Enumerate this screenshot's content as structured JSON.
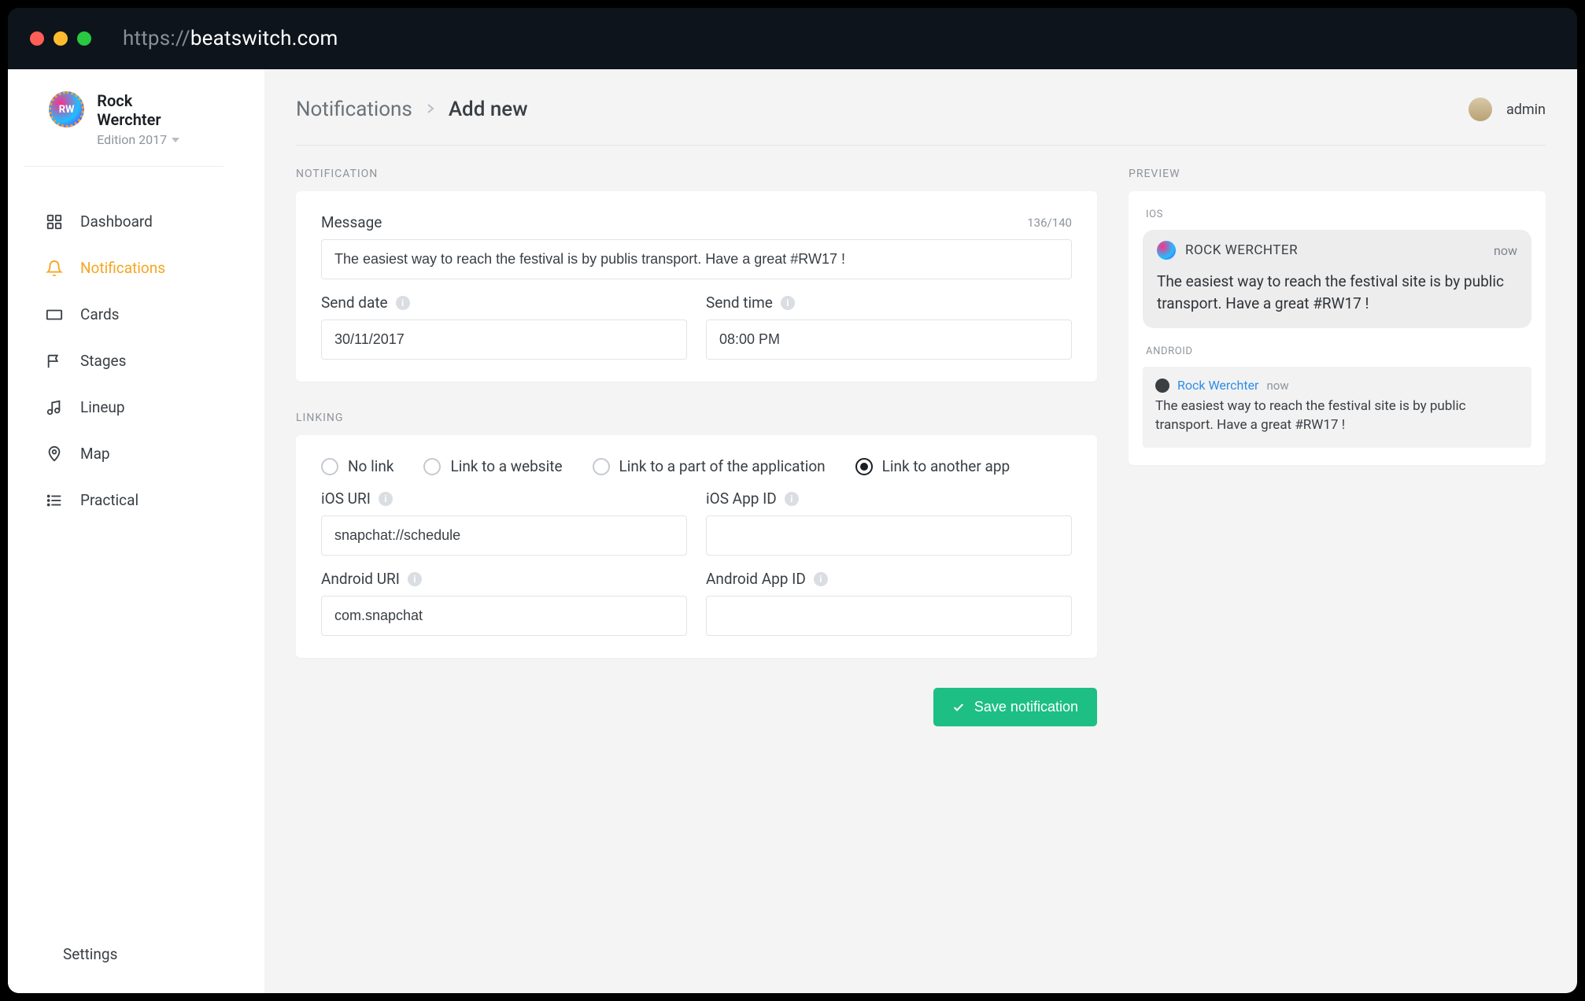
{
  "browser": {
    "url_prefix": "https://",
    "url_domain": "beatswitch.com"
  },
  "brand": {
    "title": "Rock Werchter",
    "subtitle": "Edition 2017"
  },
  "sidebar": {
    "items": [
      {
        "label": "Dashboard"
      },
      {
        "label": "Notifications"
      },
      {
        "label": "Cards"
      },
      {
        "label": "Stages"
      },
      {
        "label": "Lineup"
      },
      {
        "label": "Map"
      },
      {
        "label": "Practical"
      }
    ],
    "settings_label": "Settings"
  },
  "header": {
    "crumb_root": "Notifications",
    "crumb_current": "Add new",
    "user_label": "admin"
  },
  "notification_section": {
    "label": "NOTIFICATION",
    "message_label": "Message",
    "message_counter": "136/140",
    "message_value": "The easiest way to reach the festival is by publis transport. Have a great #RW17 !",
    "send_date_label": "Send date",
    "send_date_value": "30/11/2017",
    "send_time_label": "Send time",
    "send_time_value": "08:00 PM"
  },
  "linking_section": {
    "label": "LINKING",
    "options": [
      "No link",
      "Link to a website",
      "Link to a part of the application",
      "Link to another app"
    ],
    "ios_uri_label": "iOS URI",
    "ios_uri_value": "snapchat://schedule",
    "ios_appid_label": "iOS App ID",
    "ios_appid_value": "",
    "android_uri_label": "Android URI",
    "android_uri_value": "com.snapchat",
    "android_appid_label": "Android App ID",
    "android_appid_value": ""
  },
  "save_button_label": "Save notification",
  "preview": {
    "label": "PREVIEW",
    "ios_label": "IOS",
    "ios_app": "ROCK WERCHTER",
    "ios_time": "now",
    "ios_body": "The easiest way to reach the festival site is by public transport. Have a great #RW17 !",
    "android_label": "ANDROID",
    "android_app": "Rock Werchter",
    "android_time": "now",
    "android_body": "The easiest way to reach the festival site is by public transport.  Have a great #RW17 !"
  }
}
